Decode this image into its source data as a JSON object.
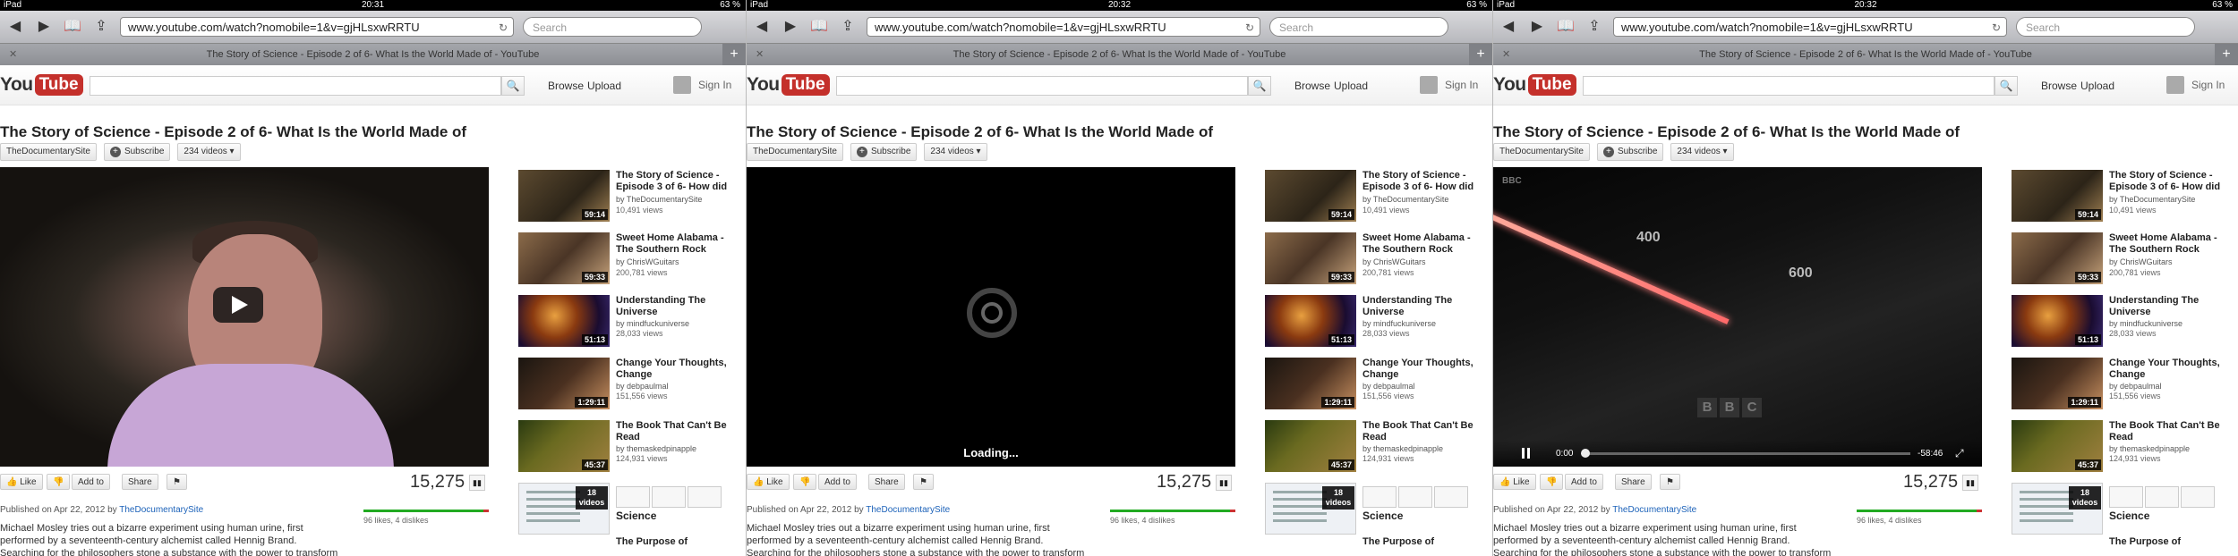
{
  "frames": [
    {
      "status": {
        "carrier": "iPad",
        "time": "20:31",
        "battery": "63 %"
      },
      "player": {
        "state": "paused"
      }
    },
    {
      "status": {
        "carrier": "iPad",
        "time": "20:32",
        "battery": "63 %"
      },
      "player": {
        "state": "loading",
        "loading_text": "Loading..."
      }
    },
    {
      "status": {
        "carrier": "iPad",
        "time": "20:32",
        "battery": "63 %"
      },
      "player": {
        "state": "playing",
        "time_current": "0:00",
        "time_remaining": "-58:46",
        "overlay_labels": [
          "400",
          "600"
        ],
        "watermark": [
          "B",
          "B",
          "C"
        ],
        "corner_logo": "BBC"
      }
    }
  ],
  "browser": {
    "url": "www.youtube.com/watch?nomobile=1&v=gjHLsxwRRTU",
    "search_placeholder": "Search",
    "tab_title": "The Story of Science - Episode 2 of 6- What Is the World Made of - YouTube"
  },
  "youtube": {
    "logo_you": "You",
    "logo_tube": "Tube",
    "nav": {
      "browse": "Browse",
      "upload": "Upload",
      "signin": "Sign In"
    },
    "video_title": "The Story of Science - Episode 2 of 6- What Is the World Made of",
    "channel": "TheDocumentarySite",
    "subscribe": "Subscribe",
    "videos_count": "234 videos",
    "actions": {
      "like": "Like",
      "add_to": "Add to",
      "share": "Share"
    },
    "view_count": "15,275",
    "published_prefix": "Published on Apr 22, 2012 by",
    "likes_text": "96 likes, 4 dislikes",
    "like_ratio": 0.96,
    "description": [
      "Michael Mosley tries out a bizarre experiment using human urine, first",
      "performed by a seventeenth-century alchemist called Hennig Brand.",
      "Searching for the philosophers stone a substance with the power to transform"
    ]
  },
  "sidebar": {
    "items": [
      {
        "title": "The Story of Science - Episode 3 of 6- How did",
        "by": "by TheDocumentarySite",
        "views": "10,491 views",
        "duration": "59:14"
      },
      {
        "title": "Sweet Home Alabama - The Southern Rock",
        "by": "by ChrisWGuitars",
        "views": "200,781 views",
        "duration": "59:33"
      },
      {
        "title": "Understanding The Universe",
        "by": "by mindfuckuniverse",
        "views": "28,033 views",
        "duration": "51:13"
      },
      {
        "title": "Change Your Thoughts, Change",
        "by": "by debpaulmal",
        "views": "151,556 views",
        "duration": "1:29:11"
      },
      {
        "title": "The Book That Can't Be Read",
        "by": "by themaskedpinapple",
        "views": "124,931 views",
        "duration": "45:37"
      }
    ],
    "mix": {
      "count": "18",
      "count_label": "videos",
      "title": "Science"
    },
    "next_partial": "The Purpose of"
  }
}
